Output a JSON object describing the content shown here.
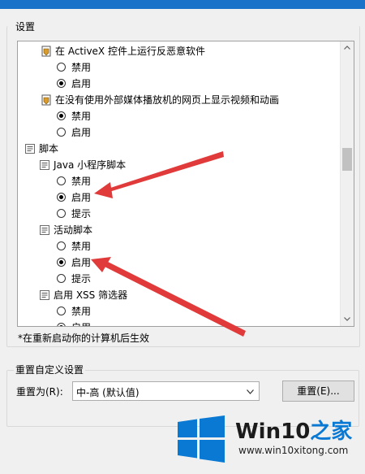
{
  "settings": {
    "group_label": "设置",
    "items": [
      {
        "kind": "setting",
        "label": "在 ActiveX 控件上运行反恶意软件"
      },
      {
        "kind": "option",
        "label": "禁用",
        "checked": false
      },
      {
        "kind": "option",
        "label": "启用",
        "checked": true
      },
      {
        "kind": "setting",
        "label": "在没有使用外部媒体播放机的网页上显示视频和动画"
      },
      {
        "kind": "option",
        "label": "禁用",
        "checked": true
      },
      {
        "kind": "option",
        "label": "启用",
        "checked": false
      },
      {
        "kind": "category",
        "label": "脚本"
      },
      {
        "kind": "subcategory",
        "label": "Java 小程序脚本"
      },
      {
        "kind": "option",
        "label": "禁用",
        "checked": false
      },
      {
        "kind": "option",
        "label": "启用",
        "checked": true
      },
      {
        "kind": "option",
        "label": "提示",
        "checked": false
      },
      {
        "kind": "subcategory",
        "label": "活动脚本"
      },
      {
        "kind": "option",
        "label": "禁用",
        "checked": false
      },
      {
        "kind": "option",
        "label": "启用",
        "checked": true
      },
      {
        "kind": "option",
        "label": "提示",
        "checked": false
      },
      {
        "kind": "subcategory",
        "label": "启用 XSS 筛选器"
      },
      {
        "kind": "option",
        "label": "禁用",
        "checked": false
      },
      {
        "kind": "option",
        "label": "启用",
        "checked": true
      }
    ],
    "footnote": "*在重新启动你的计算机后生效"
  },
  "reset": {
    "group_label": "重置自定义设置",
    "reset_to_label": "重置为(R):",
    "select_value": "中-高 (默认值)",
    "reset_button": "重置(E)..."
  },
  "watermark": {
    "brand_main": "Win10",
    "brand_accent": "之家",
    "url": "www.win10xitong.com"
  },
  "colors": {
    "titlebar": "#1a73c8",
    "arrow": "#e03a3a",
    "win_logo": "#0a79d4"
  },
  "icons": {
    "setting": "shield-gear-icon",
    "category": "script-icon",
    "scroll_up": "chevron-up-icon",
    "scroll_down": "chevron-down-icon",
    "dropdown": "chevron-down-icon"
  }
}
